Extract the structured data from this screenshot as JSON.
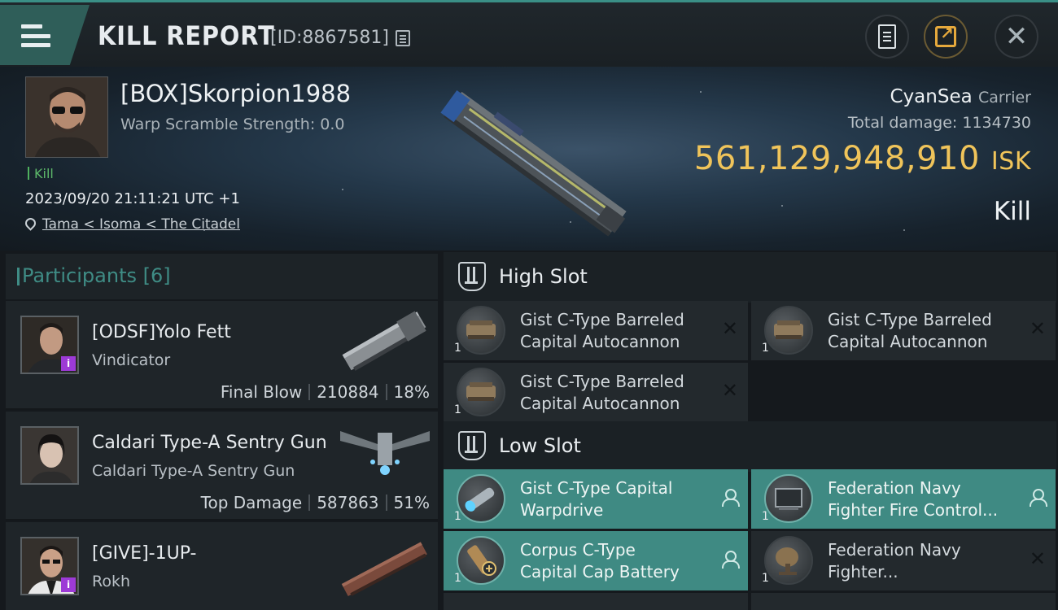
{
  "header": {
    "title": "KILL REPORT",
    "id_label": "[ID:8867581]"
  },
  "victim": {
    "name": "[BOX]Skorpion1988",
    "warp_scramble": "Warp Scramble Strength: 0.0",
    "type_tag": "Kill",
    "timestamp": "2023/09/20 21:11:21 UTC +1",
    "location": "Tama < Isoma < The Citadel",
    "corp_name": "CyanSea",
    "ship_class": "Carrier",
    "total_damage_label": "Total damage:",
    "total_damage_value": "1134730",
    "isk_value": "561,129,948,910",
    "isk_unit": "ISK",
    "result": "Kill"
  },
  "participants": {
    "title": "Participants",
    "count": "[6]",
    "rows": [
      {
        "name": "[ODSF]Yolo Fett",
        "ship": "Vindicator",
        "role": "Final Blow",
        "damage": "210884",
        "percent": "18%"
      },
      {
        "name": "Caldari Type-A Sentry Gun",
        "ship": "Caldari Type-A Sentry Gun",
        "role": "Top Damage",
        "damage": "587863",
        "percent": "51%"
      },
      {
        "name": "[GIVE]-1UP-",
        "ship": "Rokh",
        "role": "",
        "damage": "",
        "percent": ""
      }
    ]
  },
  "high_slot": {
    "title": "High Slot",
    "items": [
      {
        "line1": "Gist C-Type Barreled",
        "line2": "Capital Autocannon",
        "qty": "1"
      },
      {
        "line1": "Gist C-Type Barreled",
        "line2": "Capital Autocannon",
        "qty": "1"
      },
      {
        "line1": "Gist C-Type Barreled",
        "line2": "Capital Autocannon",
        "qty": "1"
      }
    ]
  },
  "low_slot": {
    "title": "Low Slot",
    "items": [
      {
        "line1": "Gist C-Type Capital",
        "line2": "Warpdrive",
        "qty": "1"
      },
      {
        "line1": "Federation Navy",
        "line2": "Fighter Fire Control...",
        "qty": "1"
      },
      {
        "line1": "Corpus C-Type",
        "line2": "Capital Cap Battery",
        "qty": "1"
      },
      {
        "line1": "Federation Navy",
        "line2": "Fighter...",
        "qty": "1"
      }
    ]
  },
  "icons": {
    "menu": "menu-icon",
    "copy": "copy-icon",
    "clipboard": "clipboard-icon",
    "share": "share-icon",
    "close": "close-icon",
    "location": "location-pin-icon",
    "slot": "slot-icon",
    "dropped_marker": "close-mark-icon",
    "user_marker": "user-icon"
  },
  "colors": {
    "accent_teal": "#3f8a83",
    "isk_gold": "#f0c45a",
    "kill_green": "#4fb15e",
    "corp_badge": "#9d3ad6"
  }
}
